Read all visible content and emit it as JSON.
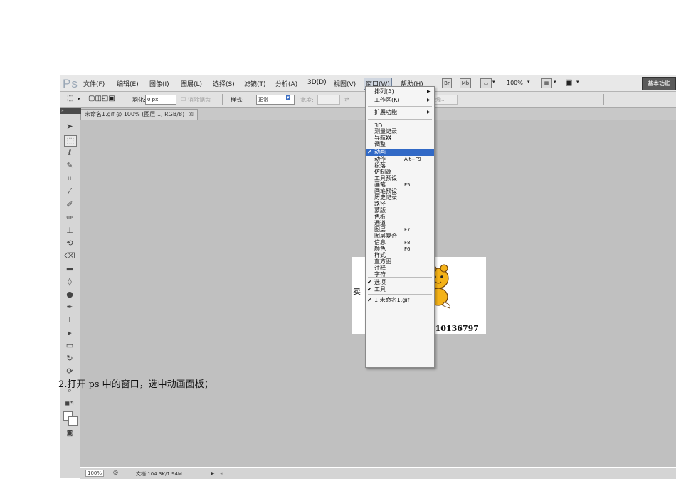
{
  "menubar": {
    "logo": "Ps",
    "items": [
      "文件(F)",
      "编辑(E)",
      "图像(I)",
      "图层(L)",
      "选择(S)",
      "滤镜(T)",
      "分析(A)",
      "3D(D)",
      "视图(V)",
      "窗口(W)",
      "帮助(H)"
    ],
    "bridge": "Br",
    "minibridge": "Mb",
    "zoom": "100%",
    "workspace": "基本功能"
  },
  "options": {
    "feather_label": "羽化:",
    "feather_value": "0 px",
    "antialias_label": "消除锯齿",
    "style_label": "样式:",
    "style_value": "正常",
    "width_label": "宽度:",
    "refine_label": "调整边缘..."
  },
  "document": {
    "tab_title": "未命名1.gif @ 100% (图层 1, RGB/8)",
    "close_glyph": "☒",
    "image_left_text": "卖",
    "image_number": "510136797"
  },
  "window_menu": {
    "items": [
      {
        "label": "排列(A)",
        "shortcut": "",
        "checked": false,
        "submenu": true,
        "highlight": false
      },
      {
        "label": "工作区(K)",
        "shortcut": "",
        "checked": false,
        "submenu": true,
        "highlight": false
      },
      {
        "label": "扩展功能",
        "shortcut": "",
        "checked": false,
        "submenu": true,
        "highlight": false
      },
      {
        "label": "3D",
        "shortcut": "",
        "checked": false,
        "submenu": false,
        "highlight": false
      },
      {
        "label": "测量记录",
        "shortcut": "",
        "checked": false,
        "submenu": false,
        "highlight": false
      },
      {
        "label": "导航器",
        "shortcut": "",
        "checked": false,
        "submenu": false,
        "highlight": false
      },
      {
        "label": "调整",
        "shortcut": "",
        "checked": false,
        "submenu": false,
        "highlight": false
      },
      {
        "label": "动画",
        "shortcut": "",
        "checked": true,
        "submenu": false,
        "highlight": true
      },
      {
        "label": "动作",
        "shortcut": "Alt+F9",
        "checked": false,
        "submenu": false,
        "highlight": false
      },
      {
        "label": "段落",
        "shortcut": "",
        "checked": false,
        "submenu": false,
        "highlight": false
      },
      {
        "label": "仿制源",
        "shortcut": "",
        "checked": false,
        "submenu": false,
        "highlight": false
      },
      {
        "label": "工具预设",
        "shortcut": "",
        "checked": false,
        "submenu": false,
        "highlight": false
      },
      {
        "label": "画笔",
        "shortcut": "F5",
        "checked": false,
        "submenu": false,
        "highlight": false
      },
      {
        "label": "画笔预设",
        "shortcut": "",
        "checked": false,
        "submenu": false,
        "highlight": false
      },
      {
        "label": "历史记录",
        "shortcut": "",
        "checked": false,
        "submenu": false,
        "highlight": false
      },
      {
        "label": "路径",
        "shortcut": "",
        "checked": false,
        "submenu": false,
        "highlight": false
      },
      {
        "label": "蒙版",
        "shortcut": "",
        "checked": false,
        "submenu": false,
        "highlight": false
      },
      {
        "label": "色板",
        "shortcut": "",
        "checked": false,
        "submenu": false,
        "highlight": false
      },
      {
        "label": "通道",
        "shortcut": "",
        "checked": false,
        "submenu": false,
        "highlight": false
      },
      {
        "label": "图层",
        "shortcut": "F7",
        "checked": false,
        "submenu": false,
        "highlight": false
      },
      {
        "label": "图层复合",
        "shortcut": "",
        "checked": false,
        "submenu": false,
        "highlight": false
      },
      {
        "label": "信息",
        "shortcut": "F8",
        "checked": false,
        "submenu": false,
        "highlight": false
      },
      {
        "label": "颜色",
        "shortcut": "F6",
        "checked": false,
        "submenu": false,
        "highlight": false
      },
      {
        "label": "样式",
        "shortcut": "",
        "checked": false,
        "submenu": false,
        "highlight": false
      },
      {
        "label": "直方图",
        "shortcut": "",
        "checked": false,
        "submenu": false,
        "highlight": false
      },
      {
        "label": "注释",
        "shortcut": "",
        "checked": false,
        "submenu": false,
        "highlight": false
      },
      {
        "label": "字符",
        "shortcut": "",
        "checked": false,
        "submenu": false,
        "highlight": false
      },
      {
        "label": "选项",
        "shortcut": "",
        "checked": true,
        "submenu": false,
        "highlight": false
      },
      {
        "label": "工具",
        "shortcut": "",
        "checked": true,
        "submenu": false,
        "highlight": false
      },
      {
        "label": "1 未命名1.gif",
        "shortcut": "",
        "checked": true,
        "submenu": false,
        "highlight": false
      }
    ]
  },
  "statusbar": {
    "zoom": "100%",
    "doc_size": "文档:104.3K/1.94M"
  },
  "caption": "2.打开 ps 中的窗口，选中动画面板；",
  "colors": {
    "highlight": "#3169c6",
    "canvas": "#c0c0c0",
    "panel": "#d6d6d6"
  }
}
